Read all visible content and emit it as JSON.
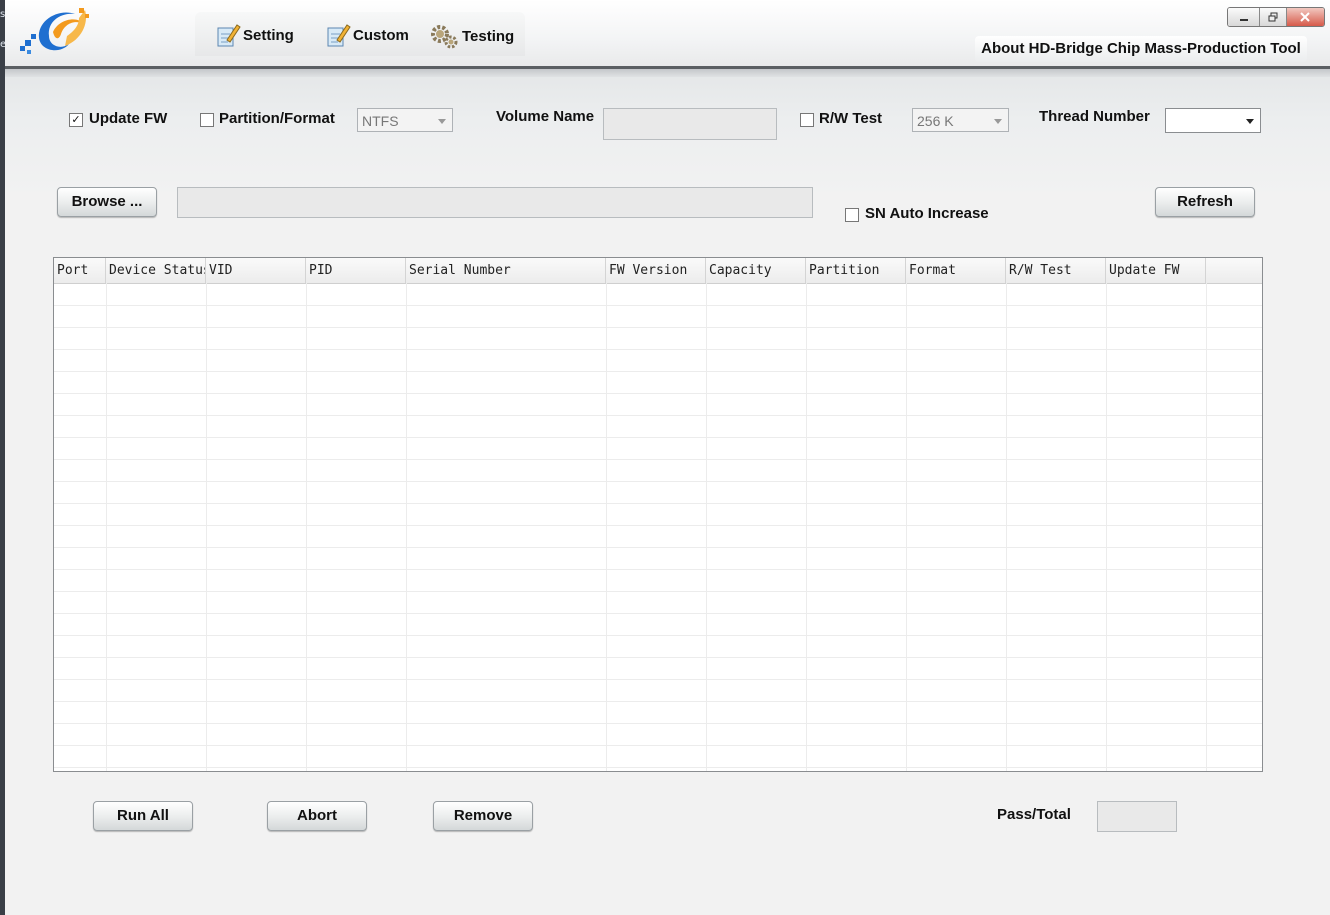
{
  "desktop_edge_text": [
    "s",
    "e"
  ],
  "tabs": [
    {
      "label": "Setting",
      "icon": "pencil-note-icon"
    },
    {
      "label": "Custom",
      "icon": "pencil-note-icon"
    },
    {
      "label": "Testing",
      "icon": "gears-icon"
    }
  ],
  "about_label": "About HD-Bridge Chip Mass-Production Tool",
  "options": {
    "update_fw": {
      "label": "Update FW",
      "checked": true
    },
    "partition_format": {
      "label": "Partition/Format",
      "checked": false,
      "select_value": "NTFS"
    },
    "volume_name": {
      "label": "Volume Name",
      "value": ""
    },
    "rw_test": {
      "label": "R/W Test",
      "checked": false,
      "select_value": "256 K"
    },
    "thread_number": {
      "label": "Thread Number",
      "value": ""
    }
  },
  "browse": {
    "label": "Browse ...",
    "path": ""
  },
  "sn_auto_increase": {
    "label": "SN Auto Increase",
    "checked": false
  },
  "refresh_label": "Refresh",
  "table": {
    "columns": [
      "Port",
      "Device Status",
      "VID",
      "PID",
      "Serial Number",
      "FW Version",
      "Capacity",
      "Partition",
      "Format",
      "R/W Test",
      "Update FW"
    ],
    "rows": []
  },
  "buttons": {
    "run_all": "Run All",
    "abort": "Abort",
    "remove": "Remove"
  },
  "pass_total": {
    "label": "Pass/Total",
    "value": ""
  },
  "colors": {
    "separator": "#5b5f63",
    "logo_blue": "#1f6fd0",
    "logo_orange": "#f39a1e",
    "close_red": "#d65a4a"
  }
}
